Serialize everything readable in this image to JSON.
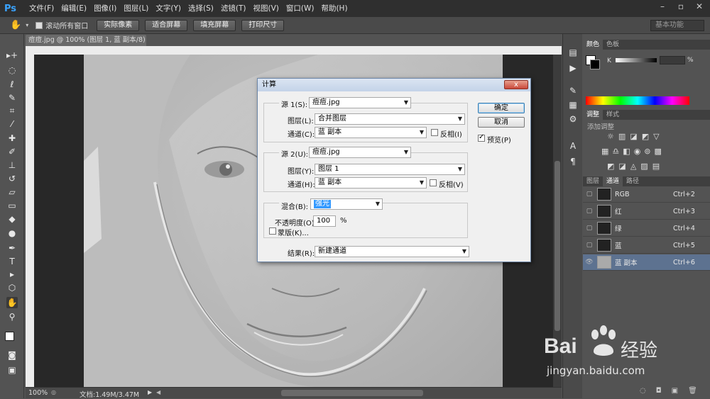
{
  "app": {
    "logo": "Ps"
  },
  "menu": [
    "文件(F)",
    "编辑(E)",
    "图像(I)",
    "图层(L)",
    "文字(Y)",
    "选择(S)",
    "滤镜(T)",
    "视图(V)",
    "窗口(W)",
    "帮助(H)"
  ],
  "options": {
    "scroll_all_label": "滚动所有窗口",
    "buttons": [
      "实际像素",
      "适合屏幕",
      "填充屏幕",
      "打印尺寸"
    ],
    "workspace": "基本功能"
  },
  "document": {
    "tab": "痘痘.jpg @ 100% (图层 1, 蓝 副本/8) *",
    "zoom": "100%",
    "doc_info": "文档:1.49M/3.47M"
  },
  "panels": {
    "color_tabs": [
      "颜色",
      "色板"
    ],
    "color_percent": "%",
    "adjust_tabs": [
      "调整",
      "样式"
    ],
    "adjust_title": "添加调整",
    "layers_tabs": [
      "图层",
      "通道",
      "路径"
    ],
    "channels": [
      {
        "name": "RGB",
        "key": "Ctrl+2",
        "selected": false
      },
      {
        "name": "红",
        "key": "Ctrl+3",
        "selected": false
      },
      {
        "name": "绿",
        "key": "Ctrl+4",
        "selected": false
      },
      {
        "name": "蓝",
        "key": "Ctrl+5",
        "selected": false
      },
      {
        "name": "蓝 副本",
        "key": "Ctrl+6",
        "selected": true
      }
    ]
  },
  "dialog": {
    "title": "计算",
    "close": "x",
    "source1": {
      "label": "源 1(S):",
      "file": "痘痘.jpg",
      "layer_label": "图层(L):",
      "layer": "合并图层",
      "channel_label": "通道(C):",
      "channel": "蓝 副本",
      "invert_label": "反相(I)"
    },
    "source2": {
      "label": "源 2(U):",
      "file": "痘痘.jpg",
      "layer_label": "图层(Y):",
      "layer": "图层 1",
      "channel_label": "通道(H):",
      "channel": "蓝 副本",
      "invert_label": "反相(V)"
    },
    "blend_label": "混合(B):",
    "blend": "强光",
    "opacity_label": "不透明度(O):",
    "opacity": "100",
    "opacity_unit": "%",
    "mask_label": "蒙版(K)...",
    "result_label": "结果(R):",
    "result": "新建通道",
    "ok": "确定",
    "cancel": "取消",
    "preview_label": "预览(P)"
  },
  "watermark": {
    "brand": "Bai",
    "brand2": "经验",
    "url": "jingyan.baidu.com"
  }
}
